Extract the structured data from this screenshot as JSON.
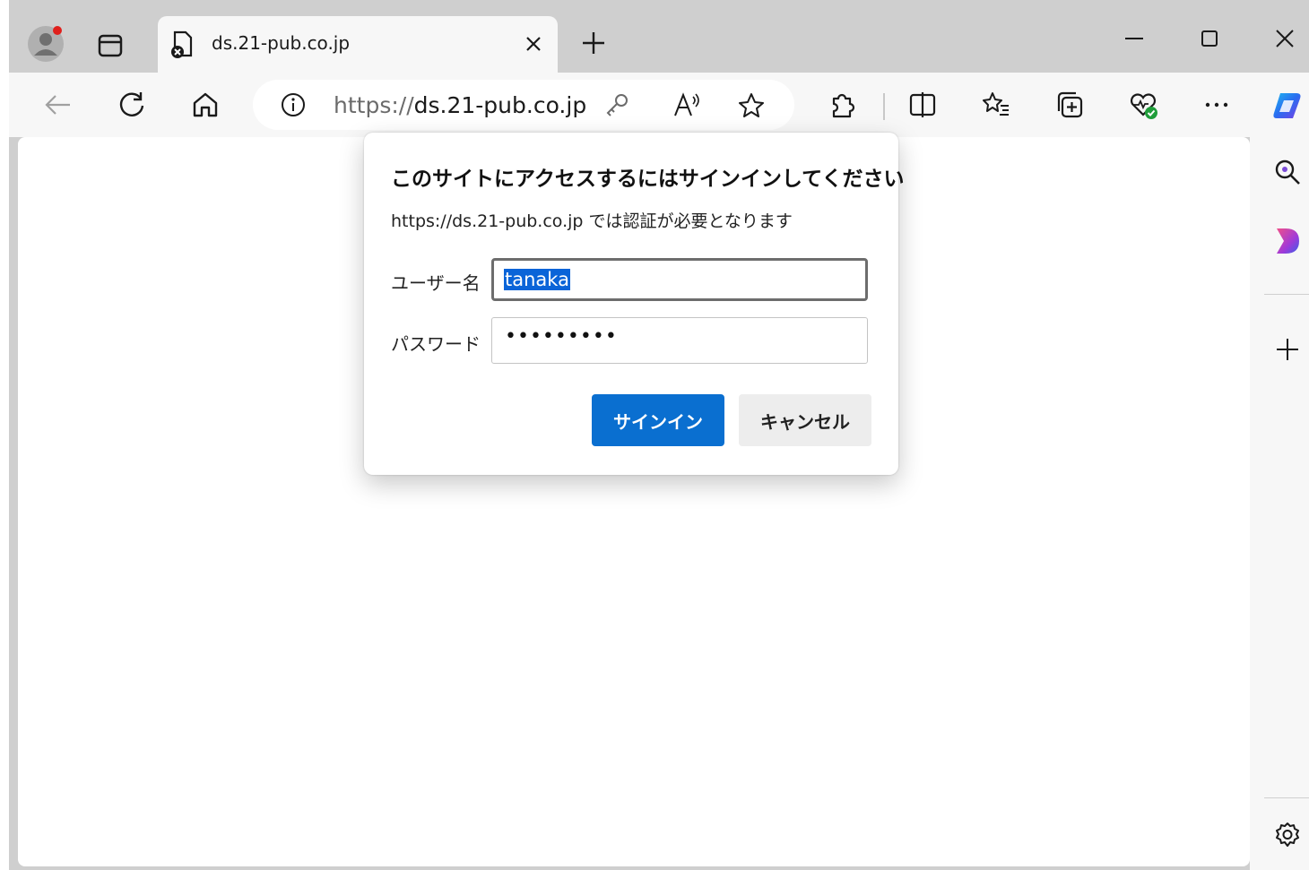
{
  "browser": {
    "tab": {
      "title": "ds.21-pub.co.jp"
    },
    "address_bar": {
      "scheme": "https://",
      "host": "ds.21-pub.co.jp"
    }
  },
  "dialog": {
    "title": "このサイトにアクセスするにはサインインしてください",
    "subtitle": "https://ds.21-pub.co.jp では認証が必要となります",
    "username_label": "ユーザー名",
    "username_value": "tanaka",
    "password_label": "パスワード",
    "password_mask": "•••••••••",
    "signin_label": "サインイン",
    "cancel_label": "キャンセル"
  },
  "colors": {
    "accent": "#0a6fd0",
    "selection": "#0a64d8",
    "chrome": "#cfcfcf"
  },
  "icons": [
    "profile-icon",
    "tab-actions-icon",
    "page-error-icon",
    "close-icon",
    "new-tab-icon",
    "minimize-icon",
    "maximize-icon",
    "back-icon",
    "refresh-icon",
    "home-icon",
    "info-icon",
    "password-key-icon",
    "read-aloud-icon",
    "favorite-star-icon",
    "extensions-icon",
    "split-screen-icon",
    "favorites-icon",
    "collections-icon",
    "browser-essentials-icon",
    "more-icon",
    "copilot-icon",
    "search-icon",
    "designer-icon",
    "add-icon",
    "settings-icon"
  ]
}
